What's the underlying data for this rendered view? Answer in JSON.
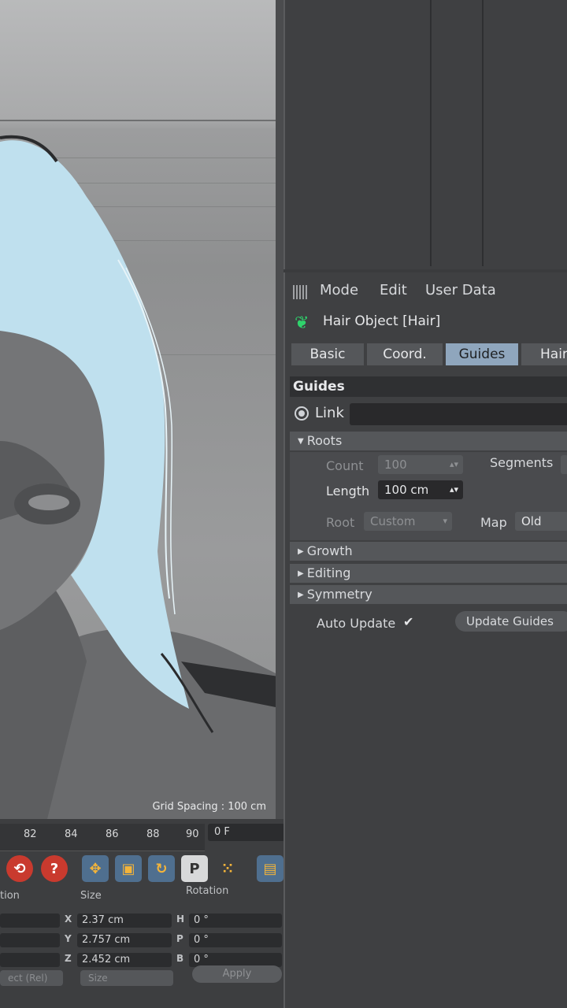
{
  "viewport": {
    "grid_spacing": "Grid Spacing : 100 cm"
  },
  "timeline": {
    "ticks": [
      "82",
      "84",
      "86",
      "88",
      "90"
    ],
    "frame": "0 F"
  },
  "coordinates": {
    "headers": {
      "position": "tion",
      "size": "Size",
      "rotation": "Rotation"
    },
    "rows": [
      {
        "axis": "X",
        "size": "2.37 cm",
        "rot_axis": "H",
        "rot": "0 °"
      },
      {
        "axis": "Y",
        "size": "2.757 cm",
        "rot_axis": "P",
        "rot": "0 °"
      },
      {
        "axis": "Z",
        "size": "2.452 cm",
        "rot_axis": "B",
        "rot": "0 °"
      }
    ],
    "mode_dropdown": "ect (Rel)",
    "size_dropdown": "Size",
    "apply_label": "Apply"
  },
  "attributes": {
    "menu": {
      "mode": "Mode",
      "edit": "Edit",
      "user_data": "User Data"
    },
    "object_title": "Hair Object [Hair]",
    "tabs": [
      {
        "label": "Basic"
      },
      {
        "label": "Coord."
      },
      {
        "label": "Guides"
      },
      {
        "label": "Hair"
      }
    ],
    "section": "Guides",
    "link_label": "Link",
    "groups": {
      "roots": "Roots",
      "growth": "Growth",
      "editing": "Editing",
      "symmetry": "Symmetry"
    },
    "roots": {
      "count_label": "Count",
      "count_value": "100",
      "segments_label": "Segments",
      "length_label": "Length",
      "length_value": "100 cm",
      "root_label": "Root",
      "root_value": "Custom",
      "map_label": "Map",
      "map_value": "Old"
    },
    "auto_update_label": "Auto Update",
    "auto_update_check": "✔",
    "update_guides_label": "Update Guides"
  },
  "colors": {
    "accent_tab": "#8fa6bd",
    "hair_icon": "#2fd36c",
    "hair_render": "#bfe0ee"
  }
}
